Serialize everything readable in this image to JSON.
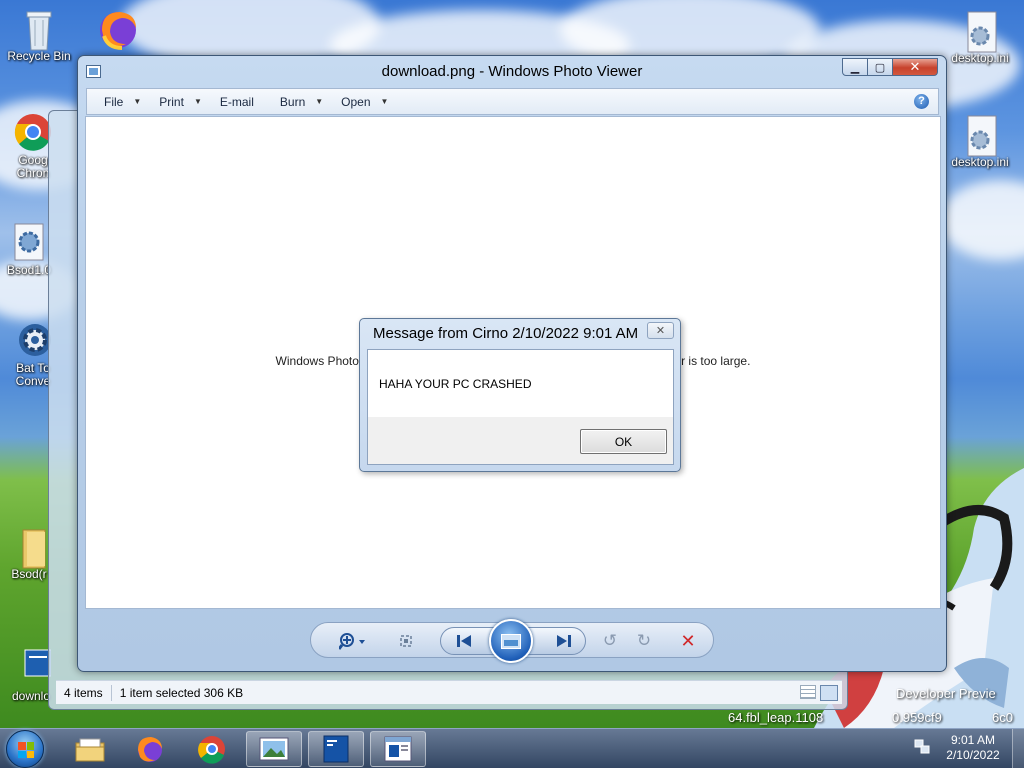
{
  "desktop": {
    "icons": [
      {
        "label": "Recycle Bin"
      },
      {
        "label": "Goog\nChron"
      },
      {
        "label": "Bsod1.0"
      },
      {
        "label": "Bat To\nConve"
      },
      {
        "label": "Bsod(r"
      },
      {
        "label": "downlo"
      },
      {
        "label": "desktop.ini"
      },
      {
        "label": "desktop.ini"
      }
    ],
    "watermark": {
      "line1": "Developer Previe",
      "line2": "64.fbl_leap.1108",
      "line3": "0.959cf9",
      "line4": "6c0"
    }
  },
  "background_window": {
    "status_items": "4 items",
    "status_selected": "1 item selected  306 KB"
  },
  "photo_viewer": {
    "title": "download.png - Windows Photo Viewer",
    "menu": [
      {
        "label": "File",
        "has_arrow": true
      },
      {
        "label": "Print",
        "has_arrow": true
      },
      {
        "label": "E-mail",
        "has_arrow": false
      },
      {
        "label": "Burn",
        "has_arrow": true
      },
      {
        "label": "Open",
        "has_arrow": true
      }
    ],
    "error_left": "Windows Photo Viewer can't",
    "error_right": "corrupted, or is too large.",
    "help_glyph": "?"
  },
  "dialog": {
    "title": "Message from Cirno 2/10/2022 9:01 AM",
    "message": "HAHA YOUR PC CRASHED",
    "ok_label": "OK"
  },
  "taskbar": {
    "time": "9:01 AM",
    "date": "2/10/2022"
  },
  "colors": {
    "accent": "#1f5fb8",
    "close_red": "#c7422c",
    "delete_red": "#d0282a"
  }
}
